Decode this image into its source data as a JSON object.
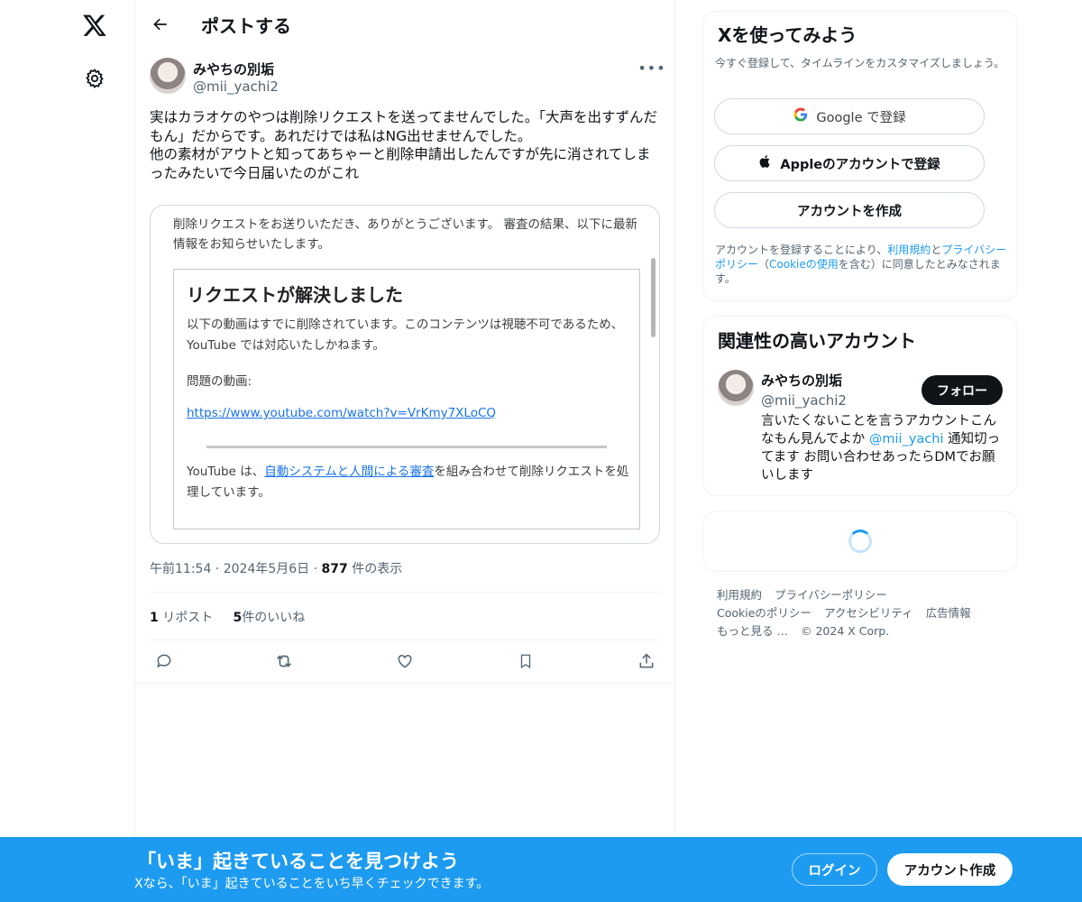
{
  "nav": {
    "logo_icon": "x-logo-icon",
    "settings_icon": "gear-icon"
  },
  "header": {
    "title": "ポストする",
    "back_icon": "back-arrow-icon"
  },
  "post": {
    "author_name": "みやちの別垢",
    "author_handle": "@mii_yachi2",
    "text": "実はカラオケのやつは削除リクエストを送ってませんでした。「大声を出すずんだもん」だからです。あれだけでは私はNG出せませんでした。\n他の素材がアウトと知ってあちゃーと削除申請出したんですが先に消されてしまったみたいで今日届いたのがこれ",
    "media": {
      "intro": "削除リクエストをお送りいただき、ありがとうございます。 審査の結果、以下に最新情報をお知らせいたします。",
      "card_title": "リクエストが解決しました",
      "body1": "以下の動画はすでに削除されています。このコンテンツは視聴不可であるため、YouTube では対応いたしかねます。",
      "body2": "問題の動画:",
      "link": "https://www.youtube.com/watch?v=VrKmy7XLoCQ",
      "body3_pre": "YouTube は、",
      "body3_link": "自動システムと人間による審査",
      "body3_post": "を組み合わせて削除リクエストを処理しています。"
    },
    "time": "午前11:54",
    "date": "2024年5月6日",
    "views_count": "877",
    "views_label": "件の表示",
    "reposts_count": "1",
    "reposts_label": "リポスト",
    "likes_count": "5",
    "likes_label": "件のいいね"
  },
  "signup": {
    "title": "Xを使ってみよう",
    "subtitle": "今すぐ登録して、タイムラインをカスタマイズしましょう。",
    "google_label": "Google で登録",
    "apple_label": "Appleのアカウントで登録",
    "create_label": "アカウントを作成",
    "legal_1": "アカウントを登録することにより、",
    "legal_terms": "利用規約",
    "legal_and": "と",
    "legal_privacy": "プライバシーポリシー",
    "legal_paren_open": "（",
    "legal_cookie": "Cookieの使用",
    "legal_2": "を含む）に同意したとみなされます。"
  },
  "related": {
    "title": "関連性の高いアカウント",
    "name": "みやちの別垢",
    "handle": "@mii_yachi2",
    "follow_label": "フォロー",
    "bio_1": "言いたくないことを言うアカウントこんなもん見んでよか ",
    "bio_mention": "@mii_yachi",
    "bio_2": " 通知切ってます お問い合わせあったらDMでお願いします"
  },
  "footer": {
    "links": [
      "利用規約",
      "プライバシーポリシー",
      "Cookieのポリシー",
      "アクセシビリティ",
      "広告情報",
      "もっと見る …"
    ],
    "copyright": "© 2024 X Corp."
  },
  "banner": {
    "title": "「いま」起きていることを見つけよう",
    "subtitle": "Xなら、「いま」起きていることをいち早くチェックできます。",
    "login_label": "ログイン",
    "create_label": "アカウント作成"
  },
  "colors": {
    "accent": "#1d9bf0",
    "text": "#0f1419",
    "muted": "#536471"
  }
}
